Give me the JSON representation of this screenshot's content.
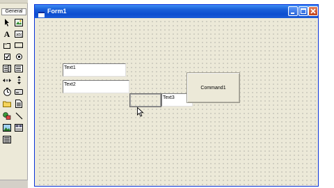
{
  "toolbox": {
    "tab_label": "General",
    "tools": [
      "pointer-icon",
      "picturebox-icon",
      "label-icon",
      "textbox-icon",
      "frame-icon",
      "commandbutton-icon",
      "checkbox-icon",
      "optionbutton-icon",
      "combobox-icon",
      "listbox-icon",
      "hscrollbar-icon",
      "vscrollbar-icon",
      "timer-icon",
      "drivelistbox-icon",
      "dirlistbox-icon",
      "filelistbox-icon",
      "shape-icon",
      "line-icon",
      "image-icon",
      "data-icon",
      "ole-icon"
    ]
  },
  "form": {
    "title": "Form1",
    "controls": {
      "text1": "Text1",
      "text2": "Text2",
      "text3": "Text3",
      "command1": "Command1"
    }
  },
  "colors": {
    "titlebar": "#0c4ed0",
    "form_background": "#ece9d8",
    "grid_dots": "#7c7c7c"
  }
}
